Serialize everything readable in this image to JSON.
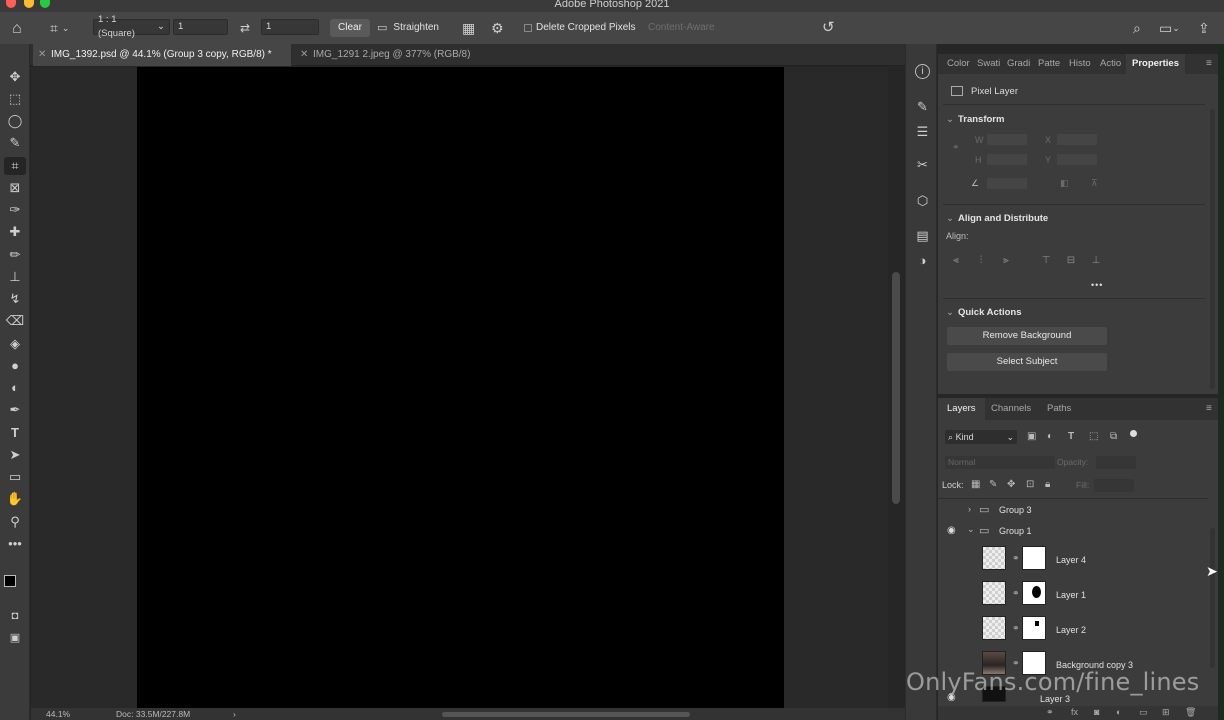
{
  "app": {
    "title": "Adobe Photoshop 2021"
  },
  "options_bar": {
    "ratio_label": "1 : 1 (Square)",
    "width_value": "1",
    "height_value": "1",
    "clear_label": "Clear",
    "straighten_label": "Straighten",
    "delete_cropped_label": "Delete Cropped Pixels",
    "content_aware_label": "Content-Aware"
  },
  "tabs": [
    {
      "label": "IMG_1392.psd @ 44.1% (Group 3 copy, RGB/8) *",
      "active": true
    },
    {
      "label": "IMG_1291 2.jpeg @ 377% (RGB/8)",
      "active": false
    }
  ],
  "status": {
    "zoom": "44.1%",
    "doc": "Doc: 33.5M/227.8M"
  },
  "properties": {
    "tabs": [
      "Color",
      "Swati",
      "Gradi",
      "Patte",
      "Histo",
      "Actio",
      "Properties"
    ],
    "active_tab": "Properties",
    "layer_kind": "Pixel Layer",
    "transform": {
      "heading": "Transform",
      "w_label": "W",
      "h_label": "H",
      "x_label": "X",
      "y_label": "Y"
    },
    "align": {
      "heading": "Align and Distribute",
      "align_label": "Align:",
      "more": "•••"
    },
    "quick_actions": {
      "heading": "Quick Actions",
      "remove_bg": "Remove Background",
      "select_subject": "Select Subject"
    }
  },
  "layers": {
    "tabs": [
      "Layers",
      "Channels",
      "Paths"
    ],
    "filter_label": "Kind",
    "blend_mode": "Normal",
    "opacity_label": "Opacity:",
    "lock_label": "Lock:",
    "fill_label": "Fill:",
    "items": [
      {
        "name": "Group 3",
        "type": "group",
        "expanded": false,
        "visible": false
      },
      {
        "name": "Group 1",
        "type": "group",
        "expanded": true,
        "visible": true
      },
      {
        "name": "Layer 4",
        "type": "layer",
        "visible": false
      },
      {
        "name": "Layer 1",
        "type": "layer",
        "visible": false
      },
      {
        "name": "Layer 2",
        "type": "layer",
        "visible": false
      },
      {
        "name": "Background copy 3",
        "type": "layer",
        "visible": false
      },
      {
        "name": "Layer 3",
        "type": "layer",
        "visible": true
      }
    ]
  },
  "watermark": "OnlyFans.com/fine_lines"
}
